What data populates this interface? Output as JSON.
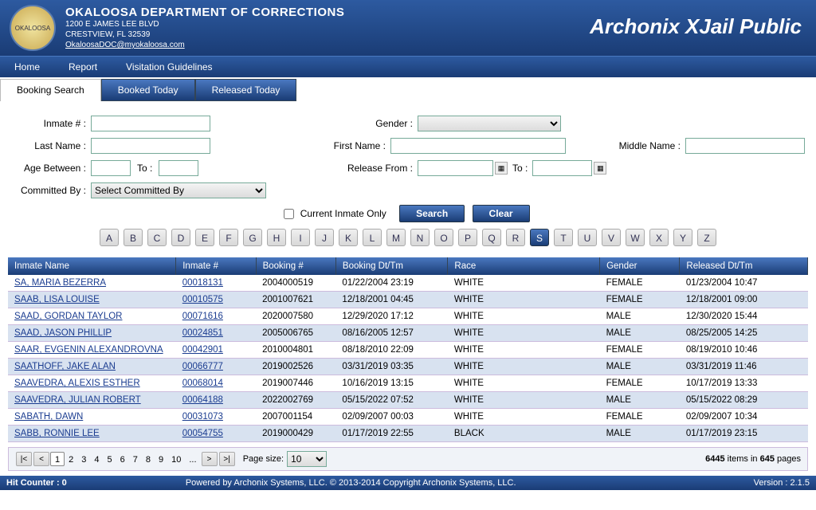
{
  "header": {
    "dept": "OKALOOSA DEPARTMENT OF CORRECTIONS",
    "addr1": "1200 E JAMES LEE BLVD",
    "addr2": "CRESTVIEW, FL 32539",
    "email": "OkaloosaDOC@myokaloosa.com",
    "brand": "Archonix XJail Public"
  },
  "menu": [
    "Home",
    "Report",
    "Visitation Guidelines"
  ],
  "tabs": [
    "Booking Search",
    "Booked Today",
    "Released Today"
  ],
  "tabs_active": 0,
  "filters": {
    "inmate_num_label": "Inmate # :",
    "last_name_label": "Last Name :",
    "first_name_label": "First Name :",
    "middle_name_label": "Middle Name :",
    "gender_label": "Gender :",
    "age_between_label": "Age Between :",
    "to_label": "To :",
    "release_from_label": "Release From :",
    "committed_by_label": "Committed By :",
    "committed_by_placeholder": "Select Committed By",
    "current_inmate_label": "Current Inmate Only",
    "search_label": "Search",
    "clear_label": "Clear"
  },
  "alpha": [
    "A",
    "B",
    "C",
    "D",
    "E",
    "F",
    "G",
    "H",
    "I",
    "J",
    "K",
    "L",
    "M",
    "N",
    "O",
    "P",
    "Q",
    "R",
    "S",
    "T",
    "U",
    "V",
    "W",
    "X",
    "Y",
    "Z"
  ],
  "alpha_selected": "S",
  "columns": [
    "Inmate Name",
    "Inmate #",
    "Booking #",
    "Booking Dt/Tm",
    "Race",
    "Gender",
    "Released Dt/Tm"
  ],
  "rows": [
    {
      "name": "SA, MARIA BEZERRA",
      "inum": "00018131",
      "bnum": "2004000519",
      "bdt": "01/22/2004 23:19",
      "race": "WHITE",
      "gender": "FEMALE",
      "rdt": "01/23/2004 10:47"
    },
    {
      "name": "SAAB, LISA LOUISE",
      "inum": "00010575",
      "bnum": "2001007621",
      "bdt": "12/18/2001 04:45",
      "race": "WHITE",
      "gender": "FEMALE",
      "rdt": "12/18/2001 09:00"
    },
    {
      "name": "SAAD, GORDAN TAYLOR",
      "inum": "00071616",
      "bnum": "2020007580",
      "bdt": "12/29/2020 17:12",
      "race": "WHITE",
      "gender": "MALE",
      "rdt": "12/30/2020 15:44"
    },
    {
      "name": "SAAD, JASON PHILLIP",
      "inum": "00024851",
      "bnum": "2005006765",
      "bdt": "08/16/2005 12:57",
      "race": "WHITE",
      "gender": "MALE",
      "rdt": "08/25/2005 14:25"
    },
    {
      "name": "SAAR, EVGENIN ALEXANDROVNA",
      "inum": "00042901",
      "bnum": "2010004801",
      "bdt": "08/18/2010 22:09",
      "race": "WHITE",
      "gender": "FEMALE",
      "rdt": "08/19/2010 10:46"
    },
    {
      "name": "SAATHOFF, JAKE ALAN",
      "inum": "00066777",
      "bnum": "2019002526",
      "bdt": "03/31/2019 03:35",
      "race": "WHITE",
      "gender": "MALE",
      "rdt": "03/31/2019 11:46"
    },
    {
      "name": "SAAVEDRA, ALEXIS ESTHER",
      "inum": "00068014",
      "bnum": "2019007446",
      "bdt": "10/16/2019 13:15",
      "race": "WHITE",
      "gender": "FEMALE",
      "rdt": "10/17/2019 13:33"
    },
    {
      "name": "SAAVEDRA, JULIAN ROBERT",
      "inum": "00064188",
      "bnum": "2022002769",
      "bdt": "05/15/2022 07:52",
      "race": "WHITE",
      "gender": "MALE",
      "rdt": "05/15/2022 08:29"
    },
    {
      "name": "SABATH, DAWN",
      "inum": "00031073",
      "bnum": "2007001154",
      "bdt": "02/09/2007 00:03",
      "race": "WHITE",
      "gender": "FEMALE",
      "rdt": "02/09/2007 10:34"
    },
    {
      "name": "SABB, RONNIE LEE",
      "inum": "00054755",
      "bnum": "2019000429",
      "bdt": "01/17/2019 22:55",
      "race": "BLACK",
      "gender": "MALE",
      "rdt": "01/17/2019 23:15"
    }
  ],
  "pager": {
    "page_size_label": "Page size:",
    "page_size": "10",
    "pages": [
      "1",
      "2",
      "3",
      "4",
      "5",
      "6",
      "7",
      "8",
      "9",
      "10",
      "..."
    ],
    "current": "1",
    "summary_items": "6445",
    "summary_items_label": " items in ",
    "summary_pages": "645",
    "summary_pages_label": " pages"
  },
  "footer": {
    "hit_counter_label": "Hit Counter : ",
    "hit_counter": "0",
    "powered": "Powered by Archonix Systems, LLC. © 2013-2014 Copyright Archonix Systems, LLC.",
    "version_label": "Version : ",
    "version": "2.1.5"
  }
}
